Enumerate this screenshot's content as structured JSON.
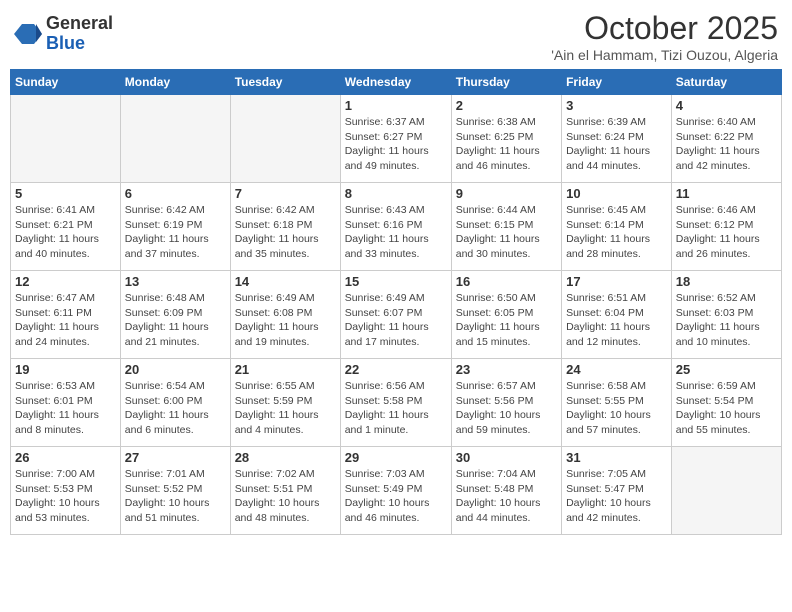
{
  "header": {
    "logo_general": "General",
    "logo_blue": "Blue",
    "month_title": "October 2025",
    "location": "'Ain el Hammam, Tizi Ouzou, Algeria"
  },
  "weekdays": [
    "Sunday",
    "Monday",
    "Tuesday",
    "Wednesday",
    "Thursday",
    "Friday",
    "Saturday"
  ],
  "weeks": [
    [
      {
        "day": "",
        "empty": true
      },
      {
        "day": "",
        "empty": true
      },
      {
        "day": "",
        "empty": true
      },
      {
        "day": "1",
        "sunrise": "Sunrise: 6:37 AM",
        "sunset": "Sunset: 6:27 PM",
        "daylight": "Daylight: 11 hours and 49 minutes."
      },
      {
        "day": "2",
        "sunrise": "Sunrise: 6:38 AM",
        "sunset": "Sunset: 6:25 PM",
        "daylight": "Daylight: 11 hours and 46 minutes."
      },
      {
        "day": "3",
        "sunrise": "Sunrise: 6:39 AM",
        "sunset": "Sunset: 6:24 PM",
        "daylight": "Daylight: 11 hours and 44 minutes."
      },
      {
        "day": "4",
        "sunrise": "Sunrise: 6:40 AM",
        "sunset": "Sunset: 6:22 PM",
        "daylight": "Daylight: 11 hours and 42 minutes."
      }
    ],
    [
      {
        "day": "5",
        "sunrise": "Sunrise: 6:41 AM",
        "sunset": "Sunset: 6:21 PM",
        "daylight": "Daylight: 11 hours and 40 minutes."
      },
      {
        "day": "6",
        "sunrise": "Sunrise: 6:42 AM",
        "sunset": "Sunset: 6:19 PM",
        "daylight": "Daylight: 11 hours and 37 minutes."
      },
      {
        "day": "7",
        "sunrise": "Sunrise: 6:42 AM",
        "sunset": "Sunset: 6:18 PM",
        "daylight": "Daylight: 11 hours and 35 minutes."
      },
      {
        "day": "8",
        "sunrise": "Sunrise: 6:43 AM",
        "sunset": "Sunset: 6:16 PM",
        "daylight": "Daylight: 11 hours and 33 minutes."
      },
      {
        "day": "9",
        "sunrise": "Sunrise: 6:44 AM",
        "sunset": "Sunset: 6:15 PM",
        "daylight": "Daylight: 11 hours and 30 minutes."
      },
      {
        "day": "10",
        "sunrise": "Sunrise: 6:45 AM",
        "sunset": "Sunset: 6:14 PM",
        "daylight": "Daylight: 11 hours and 28 minutes."
      },
      {
        "day": "11",
        "sunrise": "Sunrise: 6:46 AM",
        "sunset": "Sunset: 6:12 PM",
        "daylight": "Daylight: 11 hours and 26 minutes."
      }
    ],
    [
      {
        "day": "12",
        "sunrise": "Sunrise: 6:47 AM",
        "sunset": "Sunset: 6:11 PM",
        "daylight": "Daylight: 11 hours and 24 minutes."
      },
      {
        "day": "13",
        "sunrise": "Sunrise: 6:48 AM",
        "sunset": "Sunset: 6:09 PM",
        "daylight": "Daylight: 11 hours and 21 minutes."
      },
      {
        "day": "14",
        "sunrise": "Sunrise: 6:49 AM",
        "sunset": "Sunset: 6:08 PM",
        "daylight": "Daylight: 11 hours and 19 minutes."
      },
      {
        "day": "15",
        "sunrise": "Sunrise: 6:49 AM",
        "sunset": "Sunset: 6:07 PM",
        "daylight": "Daylight: 11 hours and 17 minutes."
      },
      {
        "day": "16",
        "sunrise": "Sunrise: 6:50 AM",
        "sunset": "Sunset: 6:05 PM",
        "daylight": "Daylight: 11 hours and 15 minutes."
      },
      {
        "day": "17",
        "sunrise": "Sunrise: 6:51 AM",
        "sunset": "Sunset: 6:04 PM",
        "daylight": "Daylight: 11 hours and 12 minutes."
      },
      {
        "day": "18",
        "sunrise": "Sunrise: 6:52 AM",
        "sunset": "Sunset: 6:03 PM",
        "daylight": "Daylight: 11 hours and 10 minutes."
      }
    ],
    [
      {
        "day": "19",
        "sunrise": "Sunrise: 6:53 AM",
        "sunset": "Sunset: 6:01 PM",
        "daylight": "Daylight: 11 hours and 8 minutes."
      },
      {
        "day": "20",
        "sunrise": "Sunrise: 6:54 AM",
        "sunset": "Sunset: 6:00 PM",
        "daylight": "Daylight: 11 hours and 6 minutes."
      },
      {
        "day": "21",
        "sunrise": "Sunrise: 6:55 AM",
        "sunset": "Sunset: 5:59 PM",
        "daylight": "Daylight: 11 hours and 4 minutes."
      },
      {
        "day": "22",
        "sunrise": "Sunrise: 6:56 AM",
        "sunset": "Sunset: 5:58 PM",
        "daylight": "Daylight: 11 hours and 1 minute."
      },
      {
        "day": "23",
        "sunrise": "Sunrise: 6:57 AM",
        "sunset": "Sunset: 5:56 PM",
        "daylight": "Daylight: 10 hours and 59 minutes."
      },
      {
        "day": "24",
        "sunrise": "Sunrise: 6:58 AM",
        "sunset": "Sunset: 5:55 PM",
        "daylight": "Daylight: 10 hours and 57 minutes."
      },
      {
        "day": "25",
        "sunrise": "Sunrise: 6:59 AM",
        "sunset": "Sunset: 5:54 PM",
        "daylight": "Daylight: 10 hours and 55 minutes."
      }
    ],
    [
      {
        "day": "26",
        "sunrise": "Sunrise: 7:00 AM",
        "sunset": "Sunset: 5:53 PM",
        "daylight": "Daylight: 10 hours and 53 minutes."
      },
      {
        "day": "27",
        "sunrise": "Sunrise: 7:01 AM",
        "sunset": "Sunset: 5:52 PM",
        "daylight": "Daylight: 10 hours and 51 minutes."
      },
      {
        "day": "28",
        "sunrise": "Sunrise: 7:02 AM",
        "sunset": "Sunset: 5:51 PM",
        "daylight": "Daylight: 10 hours and 48 minutes."
      },
      {
        "day": "29",
        "sunrise": "Sunrise: 7:03 AM",
        "sunset": "Sunset: 5:49 PM",
        "daylight": "Daylight: 10 hours and 46 minutes."
      },
      {
        "day": "30",
        "sunrise": "Sunrise: 7:04 AM",
        "sunset": "Sunset: 5:48 PM",
        "daylight": "Daylight: 10 hours and 44 minutes."
      },
      {
        "day": "31",
        "sunrise": "Sunrise: 7:05 AM",
        "sunset": "Sunset: 5:47 PM",
        "daylight": "Daylight: 10 hours and 42 minutes."
      },
      {
        "day": "",
        "empty": true
      }
    ]
  ]
}
